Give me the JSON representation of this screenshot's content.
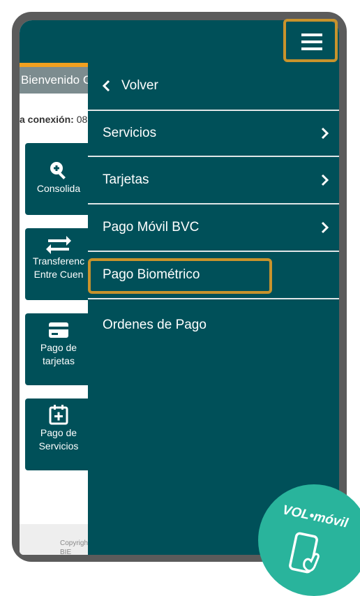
{
  "background": {
    "welcome_text": "Bienvenido C",
    "connection_label": "a conexión:",
    "connection_value": "08",
    "tiles": [
      {
        "icon": "search-plus-icon",
        "line1": "Consolida",
        "line2": ""
      },
      {
        "icon": "transfer-arrows-icon",
        "line1": "Transferenc",
        "line2": "Entre Cuen"
      },
      {
        "icon": "credit-card-icon",
        "line1": "Pago de",
        "line2": "tarjetas"
      },
      {
        "icon": "calendar-plus-icon",
        "line1": "Pago de",
        "line2": "Servicios"
      }
    ],
    "footer_text": "Copyrigh",
    "footer_text2": "BIE"
  },
  "menu": {
    "back_label": "Volver",
    "items": [
      {
        "label": "Servicios",
        "has_submenu": true
      },
      {
        "label": "Tarjetas",
        "has_submenu": true
      },
      {
        "label": "Pago Móvil BVC",
        "has_submenu": true
      },
      {
        "label": "Pago Biométrico",
        "has_submenu": false
      },
      {
        "label": "Ordenes de Pago",
        "has_submenu": false
      }
    ]
  },
  "badge": {
    "text": "VOL•móvil",
    "icon": "phone-touch-icon"
  },
  "colors": {
    "primary": "#005059",
    "highlight": "#c8932c",
    "accent": "#f0a020",
    "badge": "#29b49c"
  }
}
